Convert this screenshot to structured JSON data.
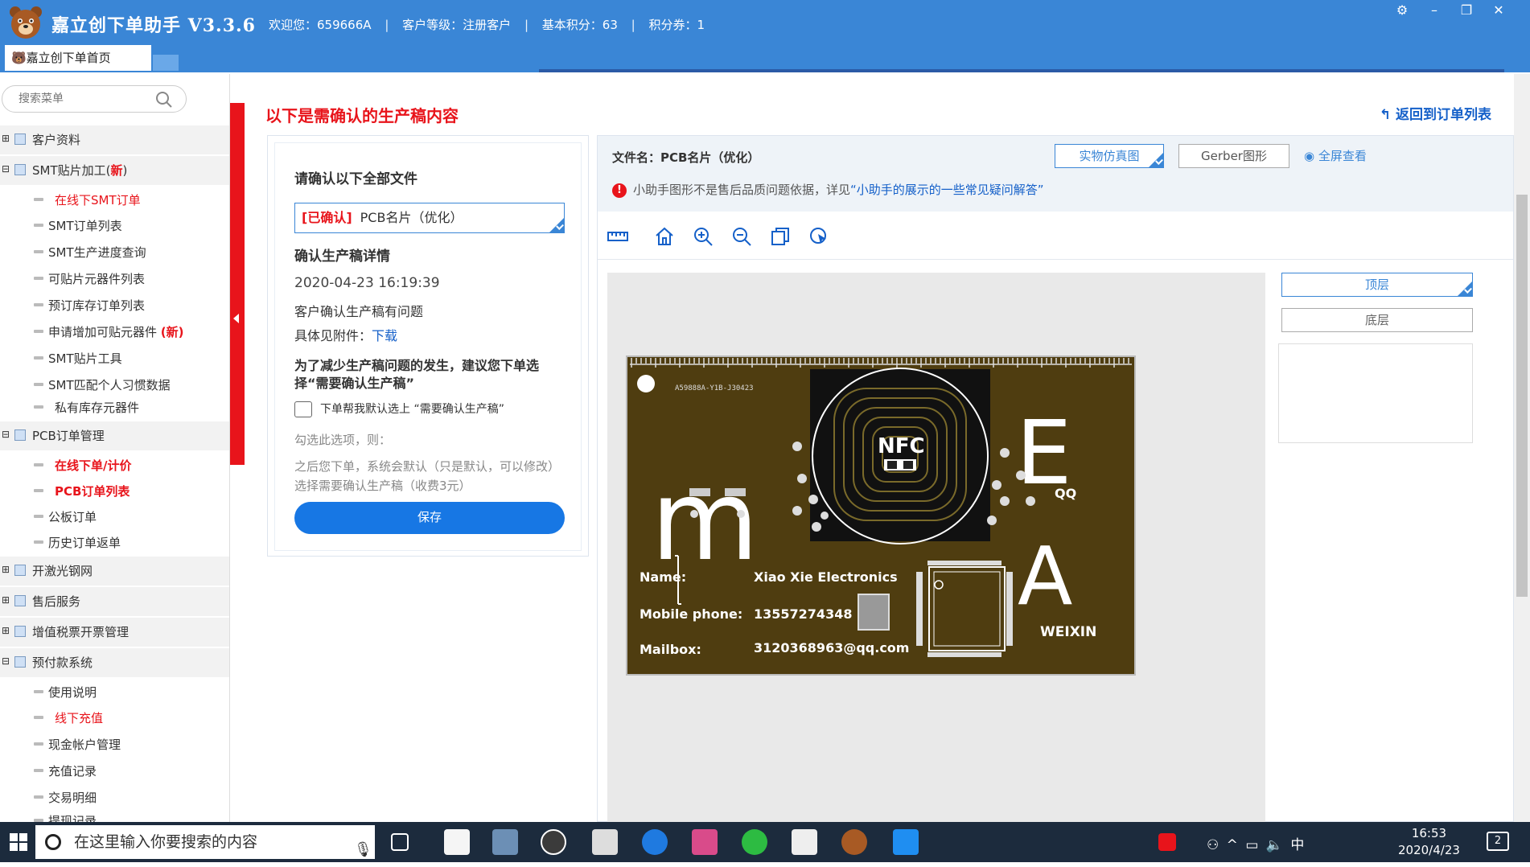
{
  "titlebar": {
    "title": "嘉立创下单助手 V3.3.6",
    "welcome": "欢迎您：659666A",
    "level": "客户等级：注册客户",
    "points": "基本积分：63",
    "coupons": "积分券：1",
    "separator": "|"
  },
  "tabs": {
    "home": "🐻嘉立创下单首页"
  },
  "search": {
    "placeholder": "搜索菜单"
  },
  "sidebar": {
    "groups": [
      {
        "label": "客户资料"
      },
      {
        "label": "SMT贴片加工(",
        "badge": "新",
        "close": ")",
        "items": [
          "在线下SMT订单",
          "SMT订单列表",
          "SMT生产进度查询",
          "可贴片元器件列表",
          "预订库存订单列表",
          "申请增加可贴元器件",
          "SMT贴片工具",
          "SMT匹配个人习惯数据",
          "私有库存元器件"
        ],
        "item_badge": "(新)"
      },
      {
        "label": "PCB订单管理",
        "items": [
          "在线下单/计价",
          "PCB订单列表",
          "公板订单",
          "历史订单返单"
        ]
      },
      {
        "label": "开激光钢网"
      },
      {
        "label": "售后服务"
      },
      {
        "label": "增值税票开票管理"
      },
      {
        "label": "预付款系统",
        "items": [
          "使用说明",
          "线下充值",
          "现金帐户管理",
          "充值记录",
          "交易明细",
          "提现记录"
        ]
      }
    ]
  },
  "main": {
    "title": "以下是需确认的生产稿内容",
    "back": "返回到订单列表",
    "confirm": {
      "heading": "请确认以下全部文件",
      "file_tag": "[已确认]",
      "file_name": "PCB名片（优化）",
      "detail_heading": "确认生产稿详情",
      "datetime": "2020-04-23 16:19:39",
      "issue": "客户确认生产稿有问题",
      "attach_label": "具体见附件：",
      "attach_link": "下载",
      "advice": "为了减少生产稿问题的发生，建议您下单选择“需要确认生产稿”",
      "checkbox_label": "下单帮我默认选上 “需要确认生产稿”",
      "then": "勾选此选项，则：",
      "note": "之后您下单，系统会默认（只是默认，可以修改）选择需要确认生产稿（收费3元）",
      "save": "保存"
    },
    "viewer": {
      "file_name": "文件名：PCB名片（优化）",
      "btn_sim": "实物仿真图",
      "btn_gerber": "Gerber图形",
      "btn_full": "全屏查看",
      "warning": "小助手图形不是售后品质问题依据，详见",
      "warning_link": "“小助手的展示的一些常见疑问解答”",
      "layer_top": "顶层",
      "layer_bottom": "底层"
    },
    "pcb": {
      "serial": "A59888A-Y1B-J30423",
      "nfc": "NFC",
      "letter_m": "m",
      "letter_e": "E",
      "letter_a": "A",
      "qq": "QQ",
      "weixin": "WEIXIN",
      "name_label": "Name:",
      "name_value": "Xiao Xie Electronics",
      "phone_label": "Mobile phone:",
      "phone_value": "13557274348",
      "mail_label": "Mailbox:",
      "mail_value": "3120368963@qq.com"
    }
  },
  "taskbar": {
    "search": "在这里输入你要搜索的内容",
    "time": "16:53",
    "date": "2020/4/23",
    "ime": "中",
    "notifications": "2"
  },
  "colors": {
    "accent": "#3a86d6",
    "red": "#e8141b",
    "pcb": "#4f3d10"
  }
}
